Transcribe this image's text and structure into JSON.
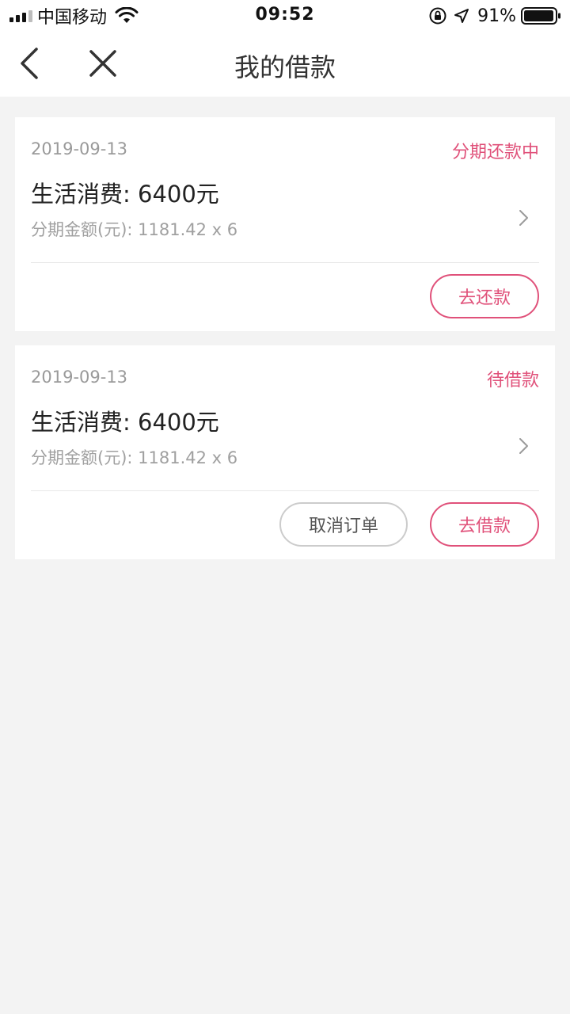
{
  "status_bar": {
    "carrier": "中国移动",
    "time": "09:52",
    "battery": "91%"
  },
  "nav": {
    "title": "我的借款"
  },
  "loans": [
    {
      "date": "2019-09-13",
      "status": "分期还款中",
      "title": "生活消费: 6400元",
      "installment": "分期金额(元): 1181.42 x 6",
      "primary_button": "去还款"
    },
    {
      "date": "2019-09-13",
      "status": "待借款",
      "title": "生活消费: 6400元",
      "installment": "分期金额(元): 1181.42 x 6",
      "secondary_button": "取消订单",
      "primary_button": "去借款"
    }
  ],
  "colors": {
    "accent": "#e0517a",
    "background": "#f3f3f3"
  }
}
